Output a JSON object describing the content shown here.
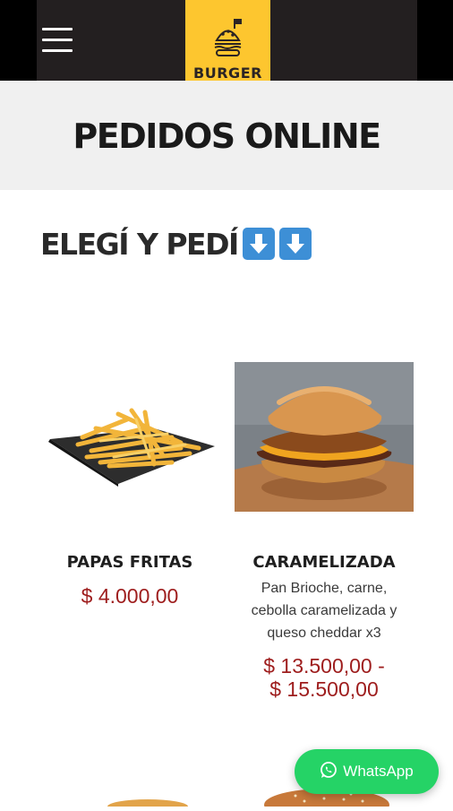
{
  "header": {
    "logo_text": "BURGER"
  },
  "hero": {
    "title": "PEDIDOS ONLINE"
  },
  "section": {
    "title": "ELEGÍ Y PEDÍ",
    "emoji_icons": [
      "down-arrow-emoji-icon",
      "down-arrow-emoji-icon"
    ]
  },
  "products": [
    {
      "name": "PAPAS FRITAS",
      "description": "",
      "price": "$ 4.000,00",
      "image_icon": "french-fries-image"
    },
    {
      "name": "CARAMELIZADA",
      "description_lines": [
        "Pan Brioche, carne,",
        "cebolla caramelizada y",
        "queso cheddar x3"
      ],
      "price_lines": [
        "$ 13.500,00 -",
        "$ 15.500,00"
      ],
      "image_icon": "burger-image"
    }
  ],
  "whatsapp": {
    "label": "WhatsApp",
    "icon": "whatsapp-icon"
  },
  "colors": {
    "header_bg": "#231f20",
    "logo_yellow": "#fdc62f",
    "hero_bg": "#f0f0f0",
    "price_red": "#9e1d1d",
    "whatsapp_green": "#25d366",
    "emoji_blue": "#3d8fd6"
  }
}
